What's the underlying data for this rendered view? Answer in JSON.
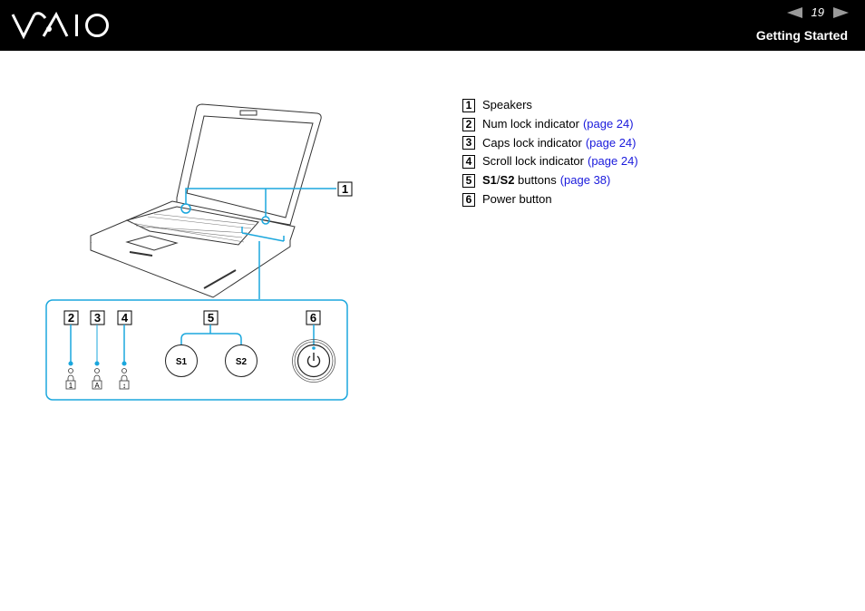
{
  "header": {
    "logo": "VAIO",
    "page_number": "19",
    "prev_icon": "triangle-left-icon",
    "next_icon": "triangle-right-icon",
    "section_title": "Getting Started"
  },
  "legend": [
    {
      "num": "1",
      "label": "Speakers",
      "link": ""
    },
    {
      "num": "2",
      "label": "Num lock indicator",
      "link": "(page 24)"
    },
    {
      "num": "3",
      "label": "Caps lock indicator",
      "link": "(page 24)"
    },
    {
      "num": "4",
      "label": "Scroll lock indicator",
      "link": "(page 24)"
    },
    {
      "num": "5",
      "label_bold_a": "S1",
      "label_sep": "/",
      "label_bold_b": "S2",
      "label_rest": " buttons",
      "link": "(page 38)"
    },
    {
      "num": "6",
      "label": "Power button",
      "link": ""
    }
  ],
  "figure": {
    "callouts": [
      "1",
      "2",
      "3",
      "4",
      "5",
      "6"
    ],
    "button_s1": "S1",
    "button_s2": "S2",
    "indicator_icons": [
      "num-lock-icon",
      "caps-lock-icon",
      "scroll-lock-icon"
    ],
    "indicator_glyphs": [
      "1",
      "A",
      "↕"
    ],
    "accent_color": "#1ba7dd"
  }
}
